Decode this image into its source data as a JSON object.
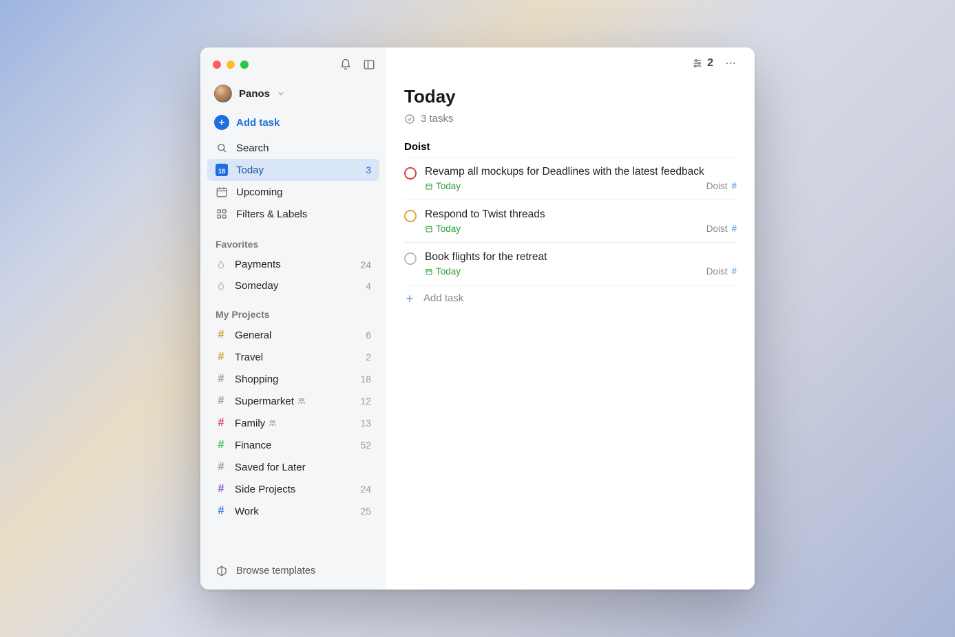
{
  "user": {
    "name": "Panos"
  },
  "sidebar": {
    "add_task_label": "Add task",
    "nav": {
      "search": "Search",
      "today": "Today",
      "today_count": "3",
      "today_cal_day": "18",
      "upcoming": "Upcoming",
      "filters": "Filters & Labels"
    },
    "favorites_header": "Favorites",
    "favorites": [
      {
        "label": "Payments",
        "count": "24"
      },
      {
        "label": "Someday",
        "count": "4"
      }
    ],
    "projects_header": "My Projects",
    "projects": [
      {
        "label": "General",
        "count": "6",
        "color": "#d1a043",
        "shared": false
      },
      {
        "label": "Travel",
        "count": "2",
        "color": "#d1a043",
        "shared": false
      },
      {
        "label": "Shopping",
        "count": "18",
        "color": "#9a9a9a",
        "shared": false
      },
      {
        "label": "Supermarket",
        "count": "12",
        "color": "#9a9a9a",
        "shared": true
      },
      {
        "label": "Family",
        "count": "13",
        "color": "#d94b7b",
        "shared": true
      },
      {
        "label": "Finance",
        "count": "52",
        "color": "#3abf5a",
        "shared": false
      },
      {
        "label": "Saved for Later",
        "count": "",
        "color": "#9a9a9a",
        "shared": false
      },
      {
        "label": "Side Projects",
        "count": "24",
        "color": "#8e5bd6",
        "shared": false
      },
      {
        "label": "Work",
        "count": "25",
        "color": "#3a84d6",
        "shared": false
      }
    ],
    "browse_templates": "Browse templates"
  },
  "main": {
    "filter_count": "2",
    "title": "Today",
    "task_summary": "3 tasks",
    "group": "Doist",
    "tasks": [
      {
        "title": "Revamp all mockups for Deadlines with the latest feedback",
        "date": "Today",
        "project": "Doist",
        "priority": "p1"
      },
      {
        "title": "Respond to Twist threads",
        "date": "Today",
        "project": "Doist",
        "priority": "p2"
      },
      {
        "title": "Book flights for the retreat",
        "date": "Today",
        "project": "Doist",
        "priority": ""
      }
    ],
    "add_task_label": "Add task"
  }
}
